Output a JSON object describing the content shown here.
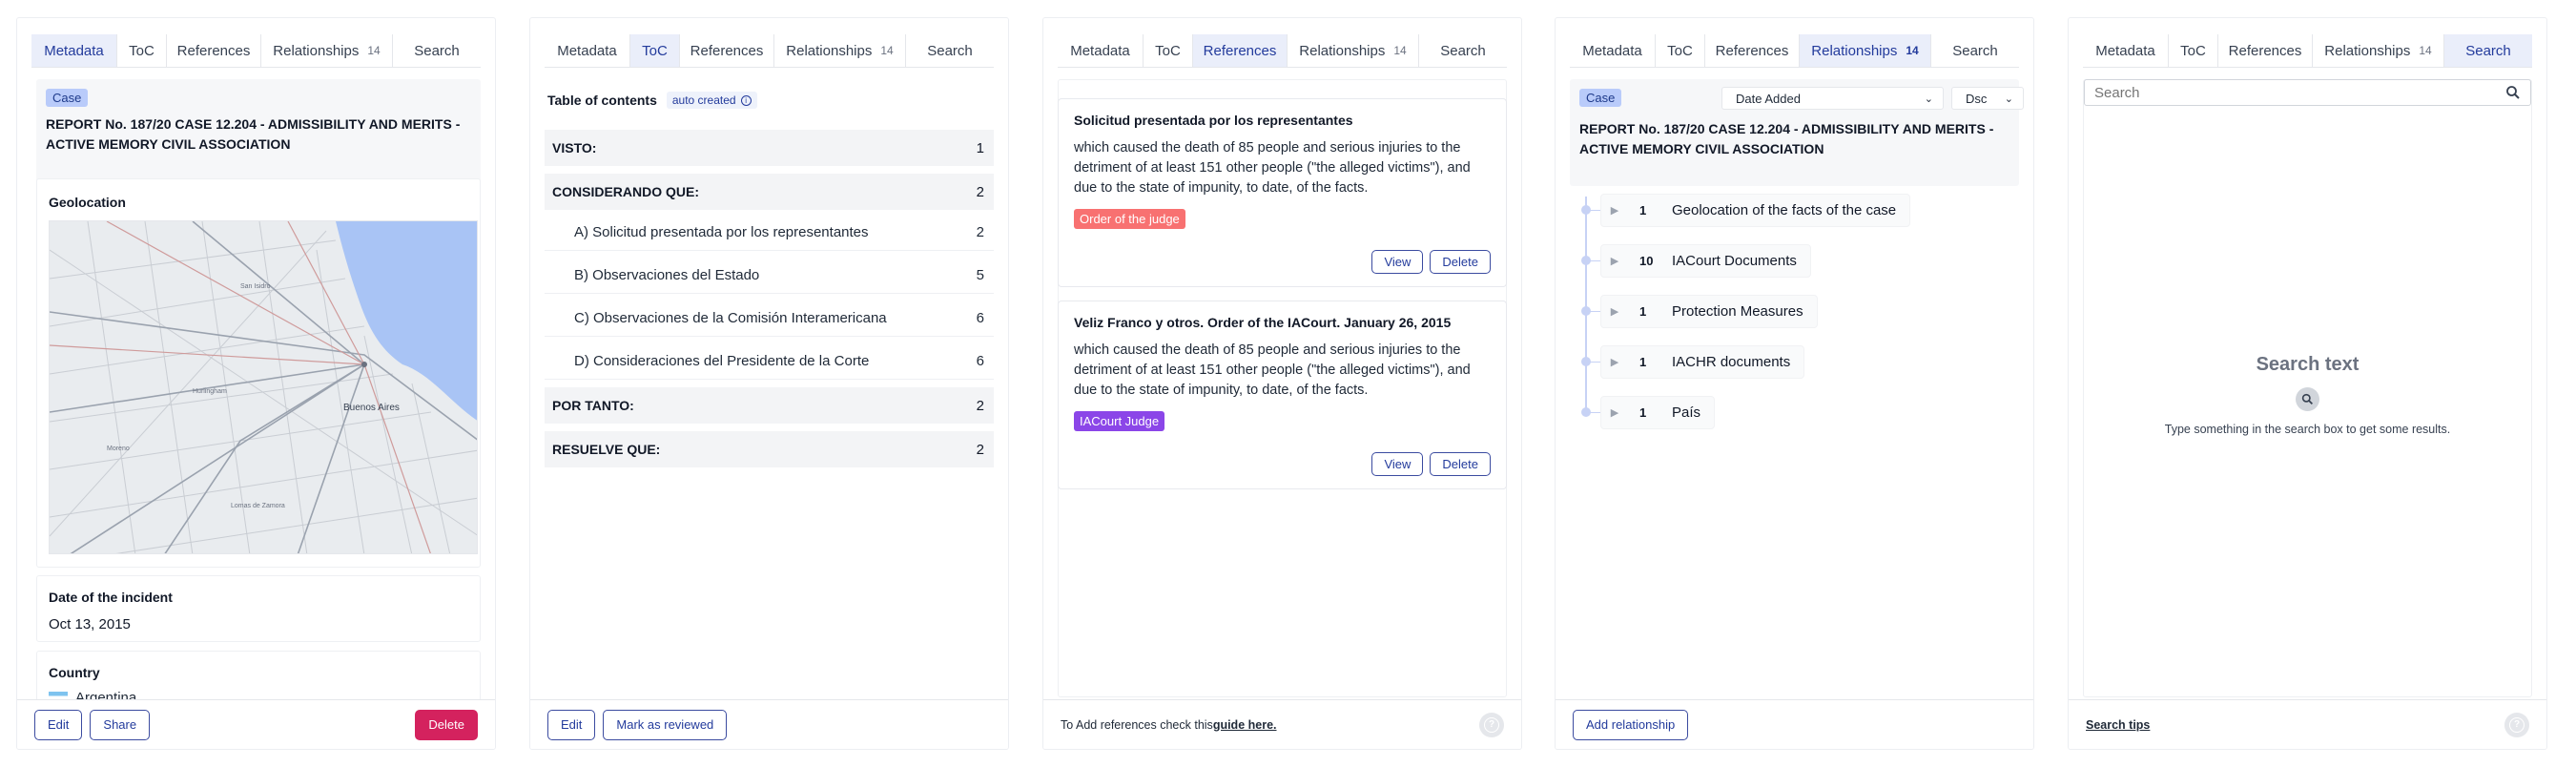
{
  "tabs": [
    "Metadata",
    "ToC",
    "References",
    "Relationships",
    "Search"
  ],
  "relationships_count": "14",
  "metadata": {
    "badge": "Case",
    "title": "REPORT No. 187/20 CASE 12.204 - ADMISSIBILITY AND MERITS - ACTIVE MEMORY CIVIL ASSOCIATION",
    "geolocation_label": "Geolocation",
    "map_city": "Buenos Aires",
    "date_label": "Date of the incident",
    "date_value": "Oct 13, 2015",
    "country_label": "Country",
    "country_value": "Argentina",
    "buttons": {
      "edit": "Edit",
      "share": "Share",
      "delete": "Delete"
    }
  },
  "toc": {
    "heading": "Table of contents",
    "auto_badge": "auto created",
    "items": [
      {
        "label": "VISTO:",
        "count": "1",
        "level": 0
      },
      {
        "label": "CONSIDERANDO QUE:",
        "count": "2",
        "level": 0
      },
      {
        "label": "A) Solicitud presentada por los representantes",
        "count": "2",
        "level": 1
      },
      {
        "label": "B) Observaciones del Estado",
        "count": "5",
        "level": 1
      },
      {
        "label": "C) Observaciones de la Comisión Interamericana",
        "count": "6",
        "level": 1
      },
      {
        "label": "D) Consideraciones del Presidente de la Corte",
        "count": "6",
        "level": 1
      },
      {
        "label": "POR TANTO:",
        "count": "2",
        "level": 0
      },
      {
        "label": "RESUELVE QUE:",
        "count": "2",
        "level": 0
      }
    ],
    "buttons": {
      "edit": "Edit",
      "review": "Mark as reviewed"
    }
  },
  "references": {
    "cards": [
      {
        "title": "Solicitud presentada por los representantes",
        "text": "which caused the death of 85 people and serious injuries to the detriment of at least 151 other people (\"the alleged victims\"), and due to the state of impunity, to date, of the facts.",
        "tag": "Order of the judge",
        "tag_color": "#f87171"
      },
      {
        "title": "Veliz Franco y otros. Order of the IACourt. January 26, 2015",
        "text": "which caused the death of 85 people and serious injuries to the detriment of at least 151 other people (\"the alleged victims\"), and due to the state of impunity, to date, of the facts.",
        "tag": "IACourt Judge",
        "tag_color": "#8b46e8"
      }
    ],
    "view_label": "View",
    "delete_label": "Delete",
    "footer_text": "To Add references check this ",
    "footer_link": "guide here."
  },
  "relationships": {
    "badge": "Case",
    "sort_select": "Date Added",
    "order_select": "Dsc",
    "title": "REPORT No. 187/20 CASE 12.204 - ADMISSIBILITY AND MERITS - ACTIVE MEMORY CIVIL ASSOCIATION",
    "items": [
      {
        "count": "1",
        "label": "Geolocation of the facts of the case"
      },
      {
        "count": "10",
        "label": "IACourt Documents"
      },
      {
        "count": "1",
        "label": "Protection Measures"
      },
      {
        "count": "1",
        "label": "IACHR documents"
      },
      {
        "count": "1",
        "label": "País"
      }
    ],
    "add_button": "Add relationship"
  },
  "search": {
    "placeholder": "Search",
    "empty_title": "Search text",
    "empty_text": "Type something in the search box to get some results.",
    "tips": "Search tips"
  },
  "colors": {
    "accent": "#233b9c",
    "tab_active_bg": "#eaeefa",
    "danger": "#d4225e"
  }
}
